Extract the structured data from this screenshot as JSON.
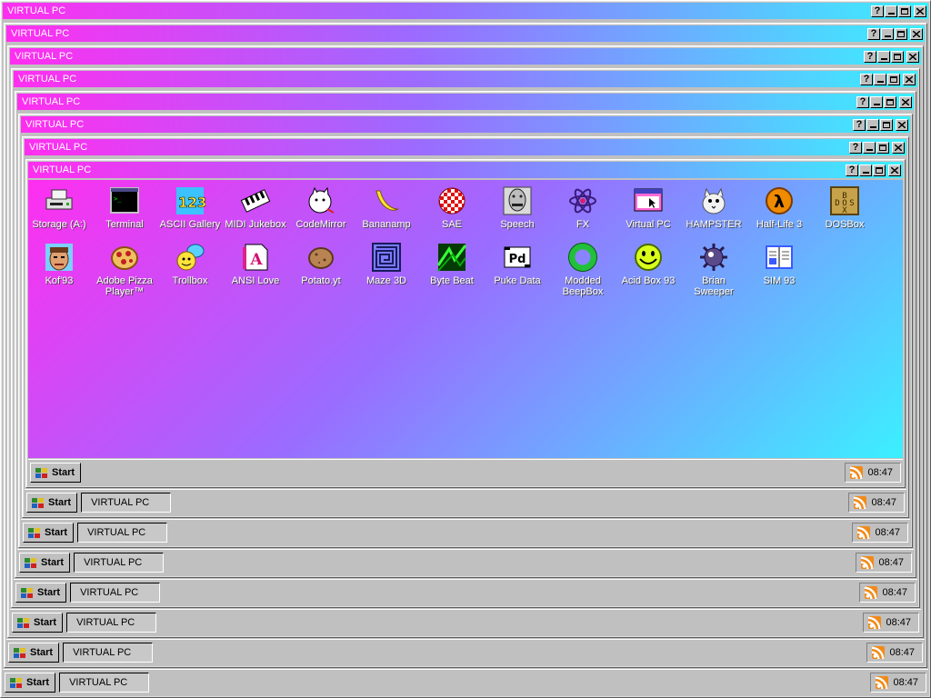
{
  "window_title": "VIRTUAL PC",
  "taskbar": {
    "start_label": "Start",
    "task_label": "VIRTUAL PC",
    "clock": "08:47"
  },
  "title_buttons": {
    "help": "?"
  },
  "desktop_icons": [
    {
      "label": "Storage (A:)",
      "icon": "floppy-drive-icon"
    },
    {
      "label": "Terminal",
      "icon": "terminal-icon"
    },
    {
      "label": "ASCII Gallery",
      "icon": "ascii-123-icon"
    },
    {
      "label": "MIDI Jukebox",
      "icon": "piano-keys-icon"
    },
    {
      "label": "CodeMirror",
      "icon": "code-cat-icon"
    },
    {
      "label": "Bananamp",
      "icon": "banana-icon"
    },
    {
      "label": "SAE",
      "icon": "checkered-ball-icon"
    },
    {
      "label": "Speech",
      "icon": "speech-face-icon"
    },
    {
      "label": "FX",
      "icon": "atom-icon"
    },
    {
      "label": "Virtual PC",
      "icon": "window-cursor-icon"
    },
    {
      "label": "HAMPSTER",
      "icon": "hamster-icon"
    },
    {
      "label": "Half-Life 3",
      "icon": "lambda-icon"
    },
    {
      "label": "DOSBox",
      "icon": "dosbox-icon"
    },
    {
      "label": "Kof'93",
      "icon": "fighter-face-icon"
    },
    {
      "label": "Adobe Pizza Player™",
      "icon": "pizza-icon"
    },
    {
      "label": "Trollbox",
      "icon": "chat-smiley-icon"
    },
    {
      "label": "ANSI Love",
      "icon": "ansi-letter-icon"
    },
    {
      "label": "Potato.yt",
      "icon": "potato-icon"
    },
    {
      "label": "Maze 3D",
      "icon": "maze-icon"
    },
    {
      "label": "Byte Beat",
      "icon": "bytebeat-icon"
    },
    {
      "label": "Puke Data",
      "icon": "pd-icon"
    },
    {
      "label": "Modded BeepBox",
      "icon": "green-ring-icon"
    },
    {
      "label": "Acid Box 93",
      "icon": "acid-smiley-icon"
    },
    {
      "label": "Brian Sweeper",
      "icon": "mine-icon"
    },
    {
      "label": "SIM 93",
      "icon": "book-icon"
    }
  ]
}
